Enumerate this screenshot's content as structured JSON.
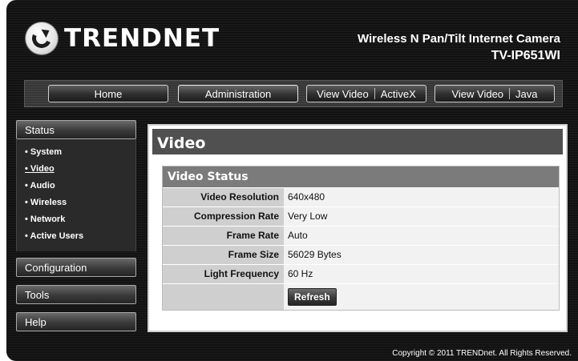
{
  "header": {
    "logo_text": "TRENDNET",
    "product_line": "Wireless N Pan/Tilt Internet Camera",
    "model": "TV-IP651WI"
  },
  "nav": {
    "home": "Home",
    "administration": "Administration",
    "view_video_activex": {
      "a": "View Video",
      "b": "ActiveX"
    },
    "view_video_java": {
      "a": "View Video",
      "b": "Java"
    }
  },
  "sidebar": {
    "status": "Status",
    "status_items": [
      "System",
      "Video",
      "Audio",
      "Wireless",
      "Network",
      "Active Users"
    ],
    "configuration": "Configuration",
    "tools": "Tools",
    "help": "Help"
  },
  "main": {
    "title": "Video",
    "section_title": "Video Status",
    "rows": [
      {
        "label": "Video Resolution",
        "value": "640x480"
      },
      {
        "label": "Compression Rate",
        "value": "Very Low"
      },
      {
        "label": "Frame Rate",
        "value": "Auto"
      },
      {
        "label": "Frame Size",
        "value": "56029 Bytes"
      },
      {
        "label": "Light Frequency",
        "value": "60 Hz"
      }
    ],
    "refresh_label": "Refresh"
  },
  "footer": {
    "copyright": "Copyright © 2011 TRENDnet. All Rights Reserved."
  }
}
